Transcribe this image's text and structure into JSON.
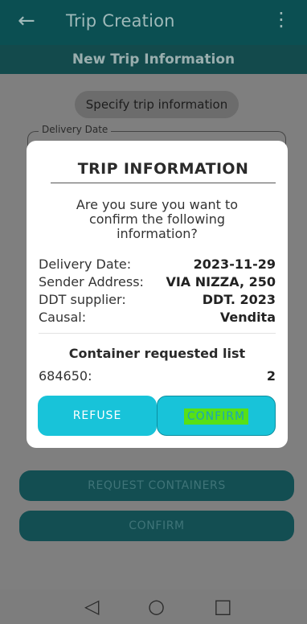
{
  "appbar": {
    "title": "Trip Creation",
    "back_icon": "arrow-left-icon",
    "menu_icon": "more-vert-icon"
  },
  "subheader": {
    "title": "New Trip Information"
  },
  "form": {
    "chip_label": "Specify trip information",
    "delivery_date_label": "Delivery Date"
  },
  "background_buttons": {
    "request_containers": "REQUEST CONTAINERS",
    "confirm": "CONFIRM"
  },
  "dialog": {
    "title": "TRIP INFORMATION",
    "question": "Are you sure you want to confirm the following information?",
    "fields": [
      {
        "label": "Delivery Date:",
        "value": "2023-11-29"
      },
      {
        "label": "Sender Address:",
        "value": "VIA NIZZA, 250"
      },
      {
        "label": "DDT supplier:",
        "value": "DDT. 2023"
      },
      {
        "label": "Causal:",
        "value": "Vendita"
      }
    ],
    "containers_title": "Container requested list",
    "containers": [
      {
        "code": "684650:",
        "qty": "2"
      }
    ],
    "refuse_label": "REFUSE",
    "confirm_label": "CONFIRM"
  },
  "navbar": {
    "back_icon": "nav-back-icon",
    "home_icon": "nav-home-icon",
    "recents_icon": "nav-recents-icon"
  },
  "colors": {
    "appbar": "#0b4f52",
    "accent": "#18c3d9",
    "highlight": "#57e016",
    "dialog_bg": "#ffffff"
  }
}
